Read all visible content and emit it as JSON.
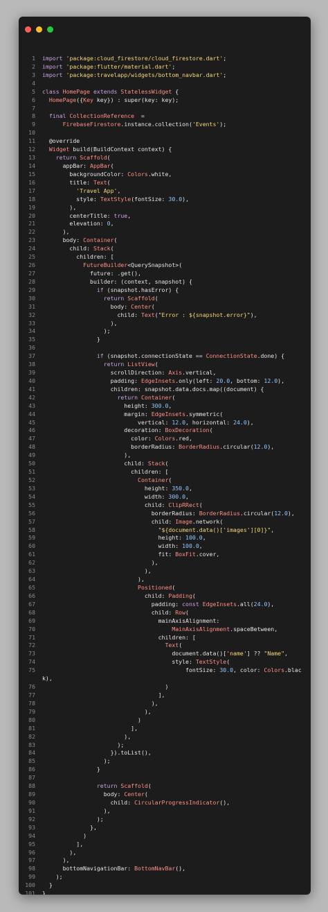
{
  "window": {
    "traffic_lights": [
      {
        "name": "close",
        "color": "#ff5f57"
      },
      {
        "name": "minimize",
        "color": "#febc2e"
      },
      {
        "name": "zoom",
        "color": "#28c840"
      }
    ]
  },
  "code": {
    "lines": [
      {
        "n": "1",
        "t": "import 'package:cloud_firestore/cloud_firestore.dart';"
      },
      {
        "n": "2",
        "t": "import 'package:flutter/material.dart';"
      },
      {
        "n": "3",
        "t": "import 'package:travelapp/widgets/bottom_navbar.dart';"
      },
      {
        "n": "4",
        "t": ""
      },
      {
        "n": "5",
        "t": "class HomePage extends StatelessWidget {"
      },
      {
        "n": "6",
        "t": "  HomePage({Key key}) : super(key: key);"
      },
      {
        "n": "7",
        "t": ""
      },
      {
        "n": "8",
        "t": "  final CollectionReference _eventRef ="
      },
      {
        "n": "9",
        "t": "      FirebaseFirestore.instance.collection('Events');"
      },
      {
        "n": "10",
        "t": ""
      },
      {
        "n": "11",
        "t": "  @override"
      },
      {
        "n": "12",
        "t": "  Widget build(BuildContext context) {"
      },
      {
        "n": "13",
        "t": "    return Scaffold("
      },
      {
        "n": "14",
        "t": "      appBar: AppBar("
      },
      {
        "n": "15",
        "t": "        backgroundColor: Colors.white,"
      },
      {
        "n": "16",
        "t": "        title: Text("
      },
      {
        "n": "17",
        "t": "          'Travel App',"
      },
      {
        "n": "18",
        "t": "          style: TextStyle(fontSize: 30.0),"
      },
      {
        "n": "19",
        "t": "        ),"
      },
      {
        "n": "20",
        "t": "        centerTitle: true,"
      },
      {
        "n": "21",
        "t": "        elevation: 0,"
      },
      {
        "n": "22",
        "t": "      ),"
      },
      {
        "n": "23",
        "t": "      body: Container("
      },
      {
        "n": "24",
        "t": "        child: Stack("
      },
      {
        "n": "25",
        "t": "          children: ["
      },
      {
        "n": "26",
        "t": "            FutureBuilder<QuerySnapshot>("
      },
      {
        "n": "27",
        "t": "              future: _eventRef.get(),"
      },
      {
        "n": "28",
        "t": "              builder: (context, snapshot) {"
      },
      {
        "n": "29",
        "t": "                if (snapshot.hasError) {"
      },
      {
        "n": "30",
        "t": "                  return Scaffold("
      },
      {
        "n": "31",
        "t": "                    body: Center("
      },
      {
        "n": "32",
        "t": "                      child: Text(\"Error : ${snapshot.error}\"),"
      },
      {
        "n": "33",
        "t": "                    ),"
      },
      {
        "n": "34",
        "t": "                  );"
      },
      {
        "n": "35",
        "t": "                }"
      },
      {
        "n": "36",
        "t": ""
      },
      {
        "n": "37",
        "t": "                if (snapshot.connectionState == ConnectionState.done) {"
      },
      {
        "n": "38",
        "t": "                  return ListView("
      },
      {
        "n": "39",
        "t": "                    scrollDirection: Axis.vertical,"
      },
      {
        "n": "40",
        "t": "                    padding: EdgeInsets.only(left: 20.0, bottom: 12.0),"
      },
      {
        "n": "41",
        "t": "                    children: snapshot.data.docs.map((document) {"
      },
      {
        "n": "42",
        "t": "                      return Container("
      },
      {
        "n": "43",
        "t": "                        height: 300.0,"
      },
      {
        "n": "44",
        "t": "                        margin: EdgeInsets.symmetric("
      },
      {
        "n": "45",
        "t": "                            vertical: 12.0, horizontal: 24.0),"
      },
      {
        "n": "46",
        "t": "                        decoration: BoxDecoration("
      },
      {
        "n": "47",
        "t": "                          color: Colors.red,"
      },
      {
        "n": "48",
        "t": "                          borderRadius: BorderRadius.circular(12.0),"
      },
      {
        "n": "49",
        "t": "                        ),"
      },
      {
        "n": "50",
        "t": "                        child: Stack("
      },
      {
        "n": "51",
        "t": "                          children: ["
      },
      {
        "n": "52",
        "t": "                            Container("
      },
      {
        "n": "53",
        "t": "                              height: 350.0,"
      },
      {
        "n": "54",
        "t": "                              width: 300.0,"
      },
      {
        "n": "55",
        "t": "                              child: ClipRRect("
      },
      {
        "n": "56",
        "t": "                                borderRadius: BorderRadius.circular(12.0),"
      },
      {
        "n": "57",
        "t": "                                child: Image.network("
      },
      {
        "n": "58",
        "t": "                                  \"${document.data()['images'][0]}\","
      },
      {
        "n": "59",
        "t": "                                  height: 100.0,"
      },
      {
        "n": "60",
        "t": "                                  width: 100.0,"
      },
      {
        "n": "61",
        "t": "                                  fit: BoxFit.cover,"
      },
      {
        "n": "62",
        "t": "                                ),"
      },
      {
        "n": "63",
        "t": "                              ),"
      },
      {
        "n": "64",
        "t": "                            ),"
      },
      {
        "n": "65",
        "t": "                            Positioned("
      },
      {
        "n": "66",
        "t": "                              child: Padding("
      },
      {
        "n": "67",
        "t": "                                padding: const EdgeInsets.all(24.0),"
      },
      {
        "n": "68",
        "t": "                                child: Row("
      },
      {
        "n": "69",
        "t": "                                  mainAxisAlignment:"
      },
      {
        "n": "70",
        "t": "                                      MainAxisAlignment.spaceBetween,"
      },
      {
        "n": "71",
        "t": "                                  children: ["
      },
      {
        "n": "72",
        "t": "                                    Text("
      },
      {
        "n": "73",
        "t": "                                      document.data()['name'] ?? \"Name\","
      },
      {
        "n": "74",
        "t": "                                      style: TextStyle("
      },
      {
        "n": "75",
        "t": "                                          fontSize: 30.0, color: Colors.blac"
      },
      {
        "n": "",
        "t": "k),"
      },
      {
        "n": "76",
        "t": "                                    )"
      },
      {
        "n": "77",
        "t": "                                  ],"
      },
      {
        "n": "78",
        "t": "                                ),"
      },
      {
        "n": "79",
        "t": "                              ),"
      },
      {
        "n": "80",
        "t": "                            )"
      },
      {
        "n": "81",
        "t": "                          ],"
      },
      {
        "n": "82",
        "t": "                        ),"
      },
      {
        "n": "83",
        "t": "                      );"
      },
      {
        "n": "84",
        "t": "                    }).toList(),"
      },
      {
        "n": "85",
        "t": "                  );"
      },
      {
        "n": "86",
        "t": "                }"
      },
      {
        "n": "87",
        "t": ""
      },
      {
        "n": "88",
        "t": "                return Scaffold("
      },
      {
        "n": "89",
        "t": "                  body: Center("
      },
      {
        "n": "90",
        "t": "                    child: CircularProgressIndicator(),"
      },
      {
        "n": "91",
        "t": "                  ),"
      },
      {
        "n": "92",
        "t": "                );"
      },
      {
        "n": "93",
        "t": "              },"
      },
      {
        "n": "94",
        "t": "            )"
      },
      {
        "n": "95",
        "t": "          ],"
      },
      {
        "n": "96",
        "t": "        ),"
      },
      {
        "n": "97",
        "t": "      ),"
      },
      {
        "n": "98",
        "t": "      bottomNavigationBar: BottomNavBar(),"
      },
      {
        "n": "99",
        "t": "    );"
      },
      {
        "n": "100",
        "t": "  }"
      },
      {
        "n": "101",
        "t": "}"
      },
      {
        "n": "102",
        "t": ""
      }
    ]
  }
}
